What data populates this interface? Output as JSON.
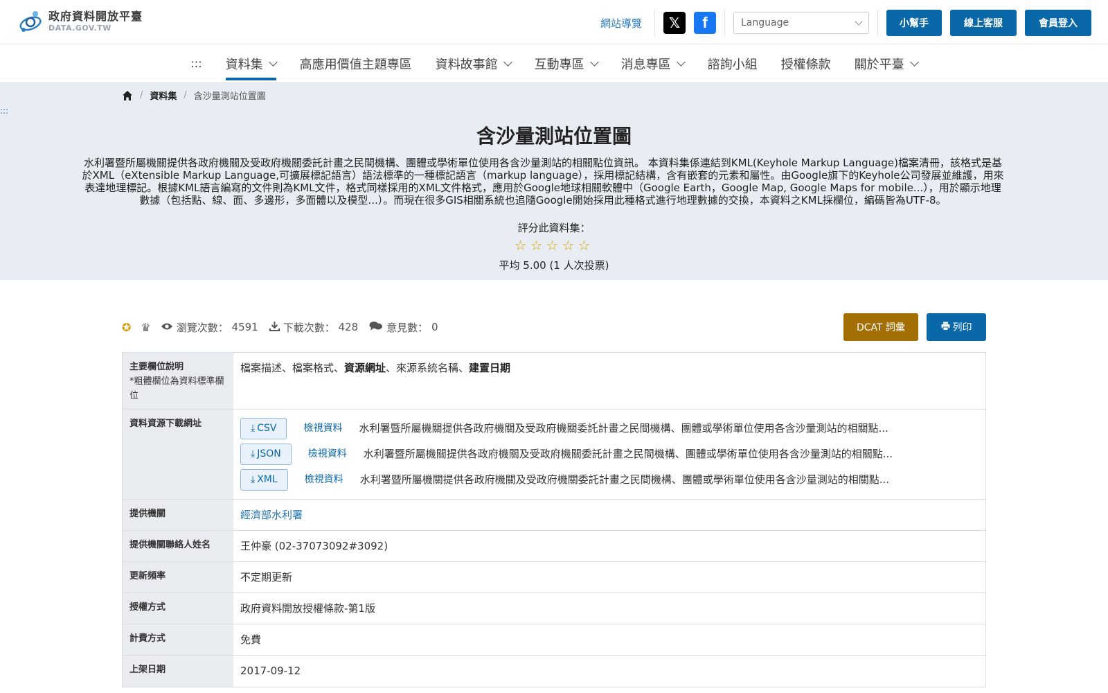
{
  "header": {
    "logo_title": "政府資料開放平臺",
    "logo_sub": "DATA.GOV.TW",
    "sitemap": "網站導覽",
    "x_icon": "x-icon",
    "facebook_icon": "facebook-icon",
    "language_placeholder": "Language",
    "help": "小幫手",
    "support": "線上客服",
    "login": "會員登入"
  },
  "nav": {
    "dots": ":::",
    "items": [
      {
        "label": "資料集",
        "dropdown": true,
        "active": true
      },
      {
        "label": "高應用價值主題專區",
        "dropdown": false
      },
      {
        "label": "資料故事館",
        "dropdown": true
      },
      {
        "label": "互動專區",
        "dropdown": true
      },
      {
        "label": "消息專區",
        "dropdown": true
      },
      {
        "label": "諮詢小組",
        "dropdown": false
      },
      {
        "label": "授權條款",
        "dropdown": false
      },
      {
        "label": "關於平臺",
        "dropdown": true
      }
    ]
  },
  "breadcrumb": {
    "level1": "資料集",
    "current": "含沙量測站位置圖"
  },
  "accessibility_dots": ":::",
  "dataset": {
    "title": "含沙量測站位置圖",
    "description": "水利署暨所屬機關提供各政府機關及受政府機關委託計畫之民間機構、團體或學術單位使用各含沙量測站的相關點位資訊。 本資料集係連結到KML(Keyhole Markup Language)檔案清冊，該格式是基於XML（eXtensible Markup Language,可擴展標記語言）語法標準的一種標記語言（markup language），採用標記結構，含有嵌套的元素和屬性。由Google旗下的Keyhole公司發展並維護，用來表達地理標記。根據KML語言編寫的文件則為KML文件，格式同樣採用的XML文件格式，應用於Google地球相關軟體中（Google Earth，Google Map, Google Maps for mobile...），用於顯示地理數據（包括點、線、面、多邊形，多面體以及模型...）。而現在很多GIS相關系統也追隨Google開始採用此種格式進行地理數據的交換，本資料之KML採欄位，編碼皆為UTF-8。",
    "rate_label": "評分此資料集：",
    "rating_stars": 5,
    "avg": "平均 5.00 (1 人次投票)"
  },
  "stats": {
    "views_label": "瀏覽次數：",
    "views": "4591",
    "downloads_label": "下載次數：",
    "downloads": "428",
    "comments_label": "意見數：",
    "comments": "0",
    "dcat": "DCAT 詞彙",
    "print": "列印"
  },
  "table": {
    "main_fields_label": "主要欄位說明",
    "main_fields_note": "*粗體欄位為資料標準欄位",
    "main_fields_a": "檔案描述、檔案格式、",
    "main_fields_b": "資源網址",
    "main_fields_c": "、來源系統名稱、",
    "main_fields_d": "建置日期",
    "download_label": "資料資源下載網址",
    "downloads": [
      {
        "format": "CSV",
        "view": "檢視資料",
        "desc": "水利署暨所屬機關提供各政府機關及受政府機關委託計畫之民間機構、團體或學術單位使用各含沙量測站的相關點..."
      },
      {
        "format": "JSON",
        "view": "檢視資料",
        "desc": "水利署暨所屬機關提供各政府機關及受政府機關委託計畫之民間機構、團體或學術單位使用各含沙量測站的相關點..."
      },
      {
        "format": "XML",
        "view": "檢視資料",
        "desc": "水利署暨所屬機關提供各政府機關及受政府機關委託計畫之民間機構、團體或學術單位使用各含沙量測站的相關點..."
      }
    ],
    "provider_label": "提供機關",
    "provider": "經濟部水利署",
    "contact_label": "提供機關聯絡人姓名",
    "contact": "王仲豪 (02-37073092#3092)",
    "freq_label": "更新頻率",
    "freq": "不定期更新",
    "license_label": "授權方式",
    "license": "政府資料開放授權條款-第1版",
    "fee_label": "計費方式",
    "fee": "免費",
    "date_label": "上架日期",
    "date": "2017-09-12"
  },
  "colors": {
    "primary": "#0a68a8",
    "dcat": "#a36f05",
    "hero_bg": "#e7edf3",
    "star": "#d9a400"
  }
}
